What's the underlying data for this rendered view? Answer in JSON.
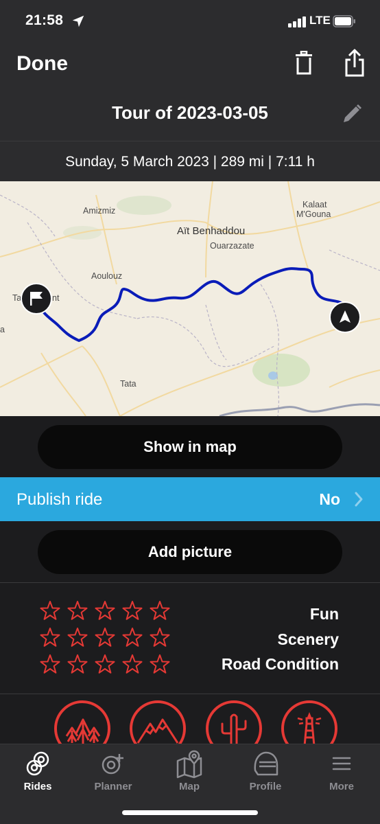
{
  "status": {
    "time": "21:58",
    "network": "LTE"
  },
  "header": {
    "done_label": "Done",
    "title": "Tour of 2023-03-05"
  },
  "summary": {
    "text": "Sunday, 5 March 2023 | 289 mi | 7:11 h"
  },
  "map": {
    "places": [
      {
        "name": "Amizmiz"
      },
      {
        "name": "Kalaat"
      },
      {
        "name": "M'Gouna"
      },
      {
        "name": "Aït Benhaddou"
      },
      {
        "name": "Ouarzazate"
      },
      {
        "name": "Aoulouz"
      },
      {
        "name": "Ta"
      },
      {
        "name": "nt"
      },
      {
        "name": "a"
      },
      {
        "name": "Tata"
      }
    ],
    "route_color": "#0a1cb8"
  },
  "actions": {
    "show_map_label": "Show in map",
    "publish_label": "Publish ride",
    "publish_value": "No",
    "add_picture_label": "Add picture"
  },
  "ratings": [
    {
      "label": "Fun",
      "stars": 0,
      "max": 5
    },
    {
      "label": "Scenery",
      "stars": 0,
      "max": 5
    },
    {
      "label": "Road Condition",
      "stars": 0,
      "max": 5
    }
  ],
  "categories": [
    {
      "icon": "forest-icon"
    },
    {
      "icon": "mountains-icon"
    },
    {
      "icon": "cactus-icon"
    },
    {
      "icon": "lighthouse-icon"
    }
  ],
  "tabs": [
    {
      "label": "Rides",
      "icon": "rides-icon",
      "active": true
    },
    {
      "label": "Planner",
      "icon": "planner-icon",
      "active": false
    },
    {
      "label": "Map",
      "icon": "map-icon",
      "active": false
    },
    {
      "label": "Profile",
      "icon": "helmet-icon",
      "active": false
    },
    {
      "label": "More",
      "icon": "menu-icon",
      "active": false
    }
  ],
  "colors": {
    "accent_red": "#e53935",
    "publish_blue": "#2ba8de",
    "background": "#1c1c1e"
  }
}
